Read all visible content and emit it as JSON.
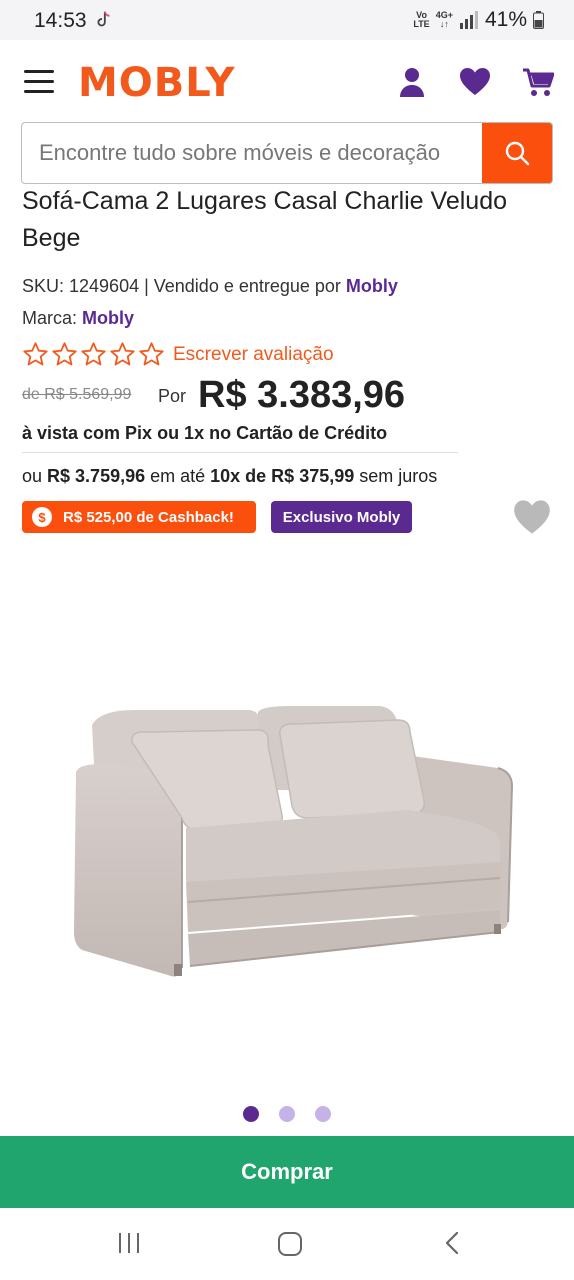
{
  "status_bar": {
    "time": "14:53",
    "network_top": "4G+",
    "volte_top": "Vo",
    "volte_bottom": "LTE",
    "battery": "41%"
  },
  "header": {
    "logo": "MOBLY",
    "search_placeholder": "Encontre tudo sobre móveis e decoração",
    "icons": [
      "menu-icon",
      "user-icon",
      "heart-icon",
      "cart-icon",
      "search-icon"
    ],
    "accent_color": "#fb4f0e",
    "brand_color": "#5b2a91"
  },
  "product": {
    "title": "Sofá-Cama 2 Lugares Casal Charlie Veludo Bege",
    "sku_label": "SKU: 1249604 | Vendido e entregue por ",
    "seller": "Mobly",
    "brand_label": "Marca: ",
    "brand": "Mobly",
    "rating_stars": 0,
    "rating_max": 5,
    "write_review": "Escrever avaliação",
    "old_price": "de R$ 5.569,99",
    "por_label": "Por",
    "price": "R$ 3.383,96",
    "pix_note": "à vista com Pix ou 1x no Cartão de Crédito",
    "installments": {
      "prefix": "ou ",
      "total": "R$ 3.759,96",
      "middle": " em até ",
      "plan": "10x de R$ 375,99",
      "suffix": " sem juros"
    },
    "cashback_badge": "R$ 525,00 de Cashback!",
    "cashback_icon": "$",
    "exclusive_badge": "Exclusivo Mobly",
    "image_count": 3,
    "image_active": 1
  },
  "actions": {
    "buy_label": "Comprar",
    "buy_color": "#1fa56d"
  },
  "nav_bar": {
    "icons": [
      "recent-apps-icon",
      "home-icon",
      "back-icon"
    ]
  }
}
